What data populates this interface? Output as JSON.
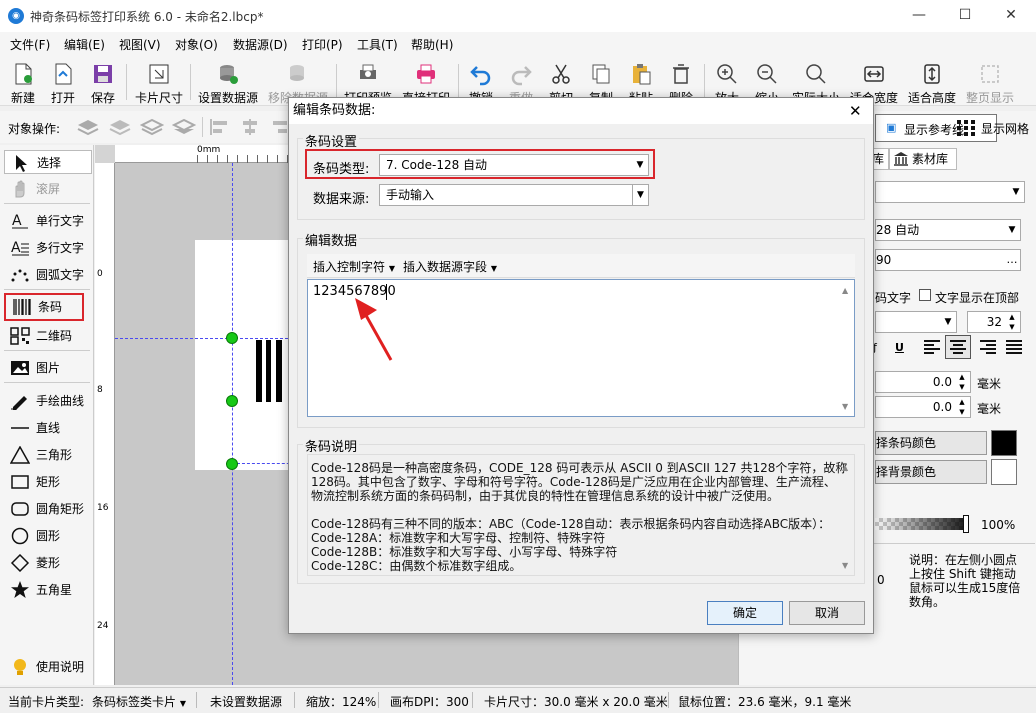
{
  "window": {
    "title": "神奇条码标签打印系统 6.0 - 未命名2.lbcp*",
    "app_icon": "app-logo-icon"
  },
  "menu": [
    "文件(F)",
    "编辑(E)",
    "视图(V)",
    "对象(O)",
    "数据源(D)",
    "打印(P)",
    "工具(T)",
    "帮助(H)"
  ],
  "toolbar": {
    "new": "新建",
    "open": "打开",
    "save": "保存",
    "card_size": "卡片尺寸",
    "set_datasource": "设置数据源",
    "remove_datasource": "移除数据源",
    "print_preview": "打印预览",
    "direct_print": "直接打印",
    "undo": "撤销",
    "redo": "重做",
    "cut": "剪切",
    "copy": "复制",
    "paste": "粘贴",
    "delete": "删除",
    "zoom_in": "放大",
    "zoom_out": "缩小",
    "actual_size": "实际大小",
    "fit_width": "适合宽度",
    "fit_height": "适合高度",
    "full_page": "整页显示"
  },
  "objbar": {
    "label": "对象操作:",
    "show_guides": "显示参考线",
    "show_grid": "显示网格"
  },
  "tools": [
    {
      "label": "选择"
    },
    {
      "label": "滚屏"
    },
    {
      "label": "单行文字"
    },
    {
      "label": "多行文字"
    },
    {
      "label": "圆弧文字"
    },
    {
      "label": "条码"
    },
    {
      "label": "二维码"
    },
    {
      "label": "图片"
    },
    {
      "label": "手绘曲线"
    },
    {
      "label": "直线"
    },
    {
      "label": "三角形"
    },
    {
      "label": "矩形"
    },
    {
      "label": "圆角矩形"
    },
    {
      "label": "圆形"
    },
    {
      "label": "菱形"
    },
    {
      "label": "五角星"
    },
    {
      "label": "使用说明"
    }
  ],
  "ruler": {
    "h0": "0mm",
    "v": [
      "0",
      "8",
      "16",
      "24"
    ]
  },
  "rightpanel": {
    "tab1": "库",
    "tab2": "素材库",
    "barcode_type": "28 自动",
    "data_value": "90",
    "text_label": "码文字",
    "text_top": "文字显示在顶部",
    "font_size": "32",
    "num1": "0.0",
    "num2": "0.0",
    "unit": "毫米",
    "barcode_color_btn": "择条码颜色",
    "bg_color_btn": "择背景颜色",
    "opacity": "100%",
    "hint": "说明：在左侧小圆点\n上按住 Shift 键拖动\n鼠标可以生成15度倍\n数角。",
    "left_zero": "0"
  },
  "dialog": {
    "title": "编辑条码数据:",
    "barcode_settings": "条码设置",
    "type_label": "条码类型:",
    "type_value": "7. Code-128 自动",
    "source_label": "数据来源:",
    "source_value": "手动输入",
    "edit_data": "编辑数据",
    "insert_ctrl": "插入控制字符",
    "insert_field": "插入数据源字段",
    "data_value": "1234567890",
    "desc_title": "条码说明",
    "desc_text": "Code-128码是一种高密度条码，CODE_128 码可表示从 ASCII 0 到ASCII 127 共128个字符，故称\n128码。其中包含了数字、字母和符号字符。Code-128码是广泛应用在企业内部管理、生产流程、\n物流控制系统方面的条码码制，由于其优良的特性在管理信息系统的设计中被广泛使用。\n\nCode-128码有三种不同的版本：ABC（Code-128自动：表示根据条码内容自动选择ABC版本）：\nCode-128A：标准数字和大写字母、控制符、特殊字符\nCode-128B：标准数字和大写字母、小写字母、特殊字符\nCode-128C：由偶数个标准数字组成。",
    "ok": "确定",
    "cancel": "取消"
  },
  "status": {
    "card_type_label": "当前卡片类型:",
    "card_type": "条码标签类卡片",
    "datasource": "未设置数据源",
    "zoom": "缩放：124%",
    "dpi": "画布DPI：300",
    "card_size": "卡片尺寸：30.0 毫米 x 20.0 毫米",
    "mouse_pos": "鼠标位置：23.6 毫米，9.1 毫米"
  },
  "colors": {
    "highlight": "#d9262c",
    "accent": "#1f7ad6",
    "handle": "#17c817"
  }
}
